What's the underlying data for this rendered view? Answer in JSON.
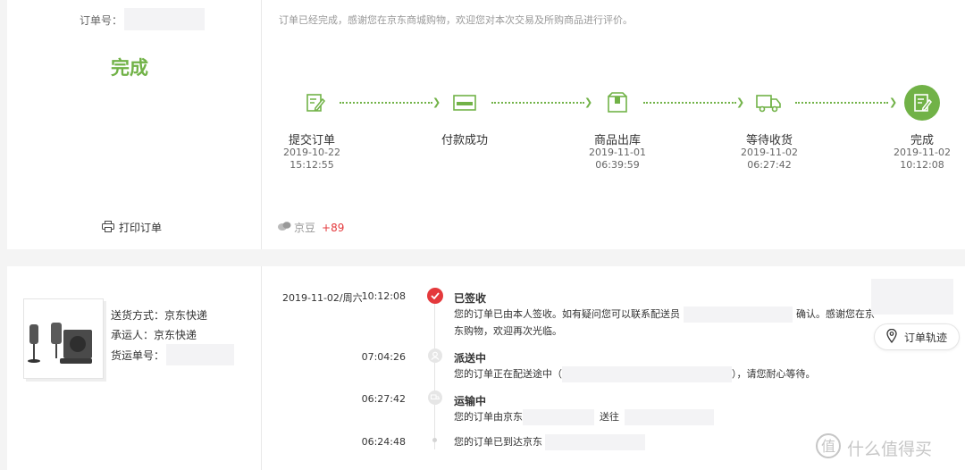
{
  "order": {
    "order_no_label": "订单号：",
    "status": "完成",
    "print_label": "打印订单",
    "notice": "订单已经完成，感谢您在京东商城购物，欢迎您对本次交易及所购商品进行评价。"
  },
  "progress": {
    "steps": [
      {
        "label": "提交订单",
        "date": "2019-10-22",
        "time": "15:12:55",
        "icon": "edit-order-icon"
      },
      {
        "label": "付款成功",
        "date": "",
        "time": "",
        "icon": "payment-card-icon"
      },
      {
        "label": "商品出库",
        "date": "2019-11-01",
        "time": "06:39:59",
        "icon": "package-icon"
      },
      {
        "label": "等待收货",
        "date": "2019-11-02",
        "time": "06:27:42",
        "icon": "truck-icon"
      },
      {
        "label": "完成",
        "date": "2019-11-02",
        "time": "10:12:08",
        "icon": "complete-icon"
      }
    ]
  },
  "beans": {
    "label": "京豆",
    "value": "+89"
  },
  "shipping": {
    "method": "送货方式：京东快递",
    "carrier": "承运人：京东快递",
    "tracking_label": "货运单号："
  },
  "timeline": {
    "date": "2019-11-02/周六",
    "entries": [
      {
        "time": "10:12:08",
        "title": "已签收",
        "desc_a": "您的订单已由本人签收。如有疑问您可以联系配送员",
        "desc_b": "确认。感谢您在京",
        "desc_c": "东购物，欢迎再次光临。"
      },
      {
        "time": "07:04:26",
        "title": "派送中",
        "desc_a": "您的订单正在配送途中（",
        "desc_b": "），请您耐心等待。"
      },
      {
        "time": "06:27:42",
        "title": "运输中",
        "desc_a": "您的订单由京东",
        "desc_b": "送往"
      },
      {
        "time": "06:24:48",
        "title": "",
        "desc_a": "您的订单已到达京东"
      }
    ]
  },
  "track_button": "订单轨迹",
  "watermark": "什么值得买",
  "colors": {
    "accent": "#71b247",
    "red": "#e4393c"
  }
}
